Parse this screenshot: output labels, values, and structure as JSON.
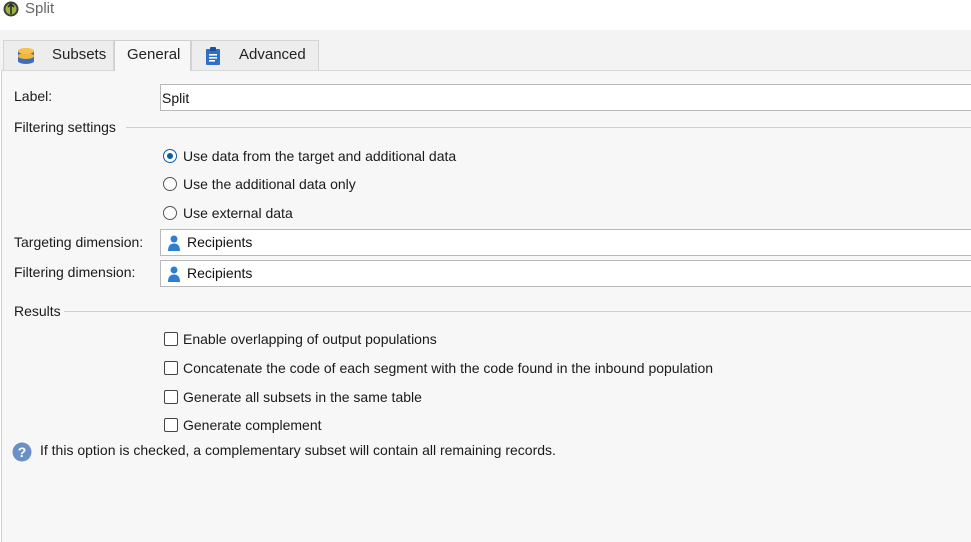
{
  "window": {
    "title": "Split",
    "icon": "split-activity-icon"
  },
  "tabs": [
    {
      "label": "Subsets",
      "icon": "database-icon",
      "active": false
    },
    {
      "label": "General",
      "icon": "",
      "active": true
    },
    {
      "label": "Advanced",
      "icon": "clipboard-icon",
      "active": false
    }
  ],
  "general": {
    "label_caption": "Label:",
    "label_value": "Split",
    "filtering_section": "Filtering settings",
    "filtering_options": [
      {
        "label": "Use data from the target and additional data",
        "checked": true
      },
      {
        "label": "Use the additional data only",
        "checked": false
      },
      {
        "label": "Use external data",
        "checked": false
      }
    ],
    "targeting_dimension": {
      "caption": "Targeting dimension:",
      "value": "Recipients",
      "icon": "recipient-icon"
    },
    "filtering_dimension": {
      "caption": "Filtering dimension:",
      "value": "Recipients",
      "icon": "recipient-icon"
    },
    "results_section": "Results",
    "results_options": [
      {
        "label": "Enable overlapping of output populations",
        "checked": false
      },
      {
        "label": "Concatenate the code of each segment with the code found in the inbound population",
        "checked": false
      },
      {
        "label": "Generate all subsets in the same table",
        "checked": false
      },
      {
        "label": "Generate complement",
        "checked": false
      }
    ],
    "info_text": "If this option is checked, a complementary subset will contain all remaining records.",
    "info_icon": "help-icon"
  },
  "colors": {
    "accent": "#0b5cad",
    "recipient_icon": "#2e7fd1",
    "help_icon": "#6b8fc7"
  }
}
